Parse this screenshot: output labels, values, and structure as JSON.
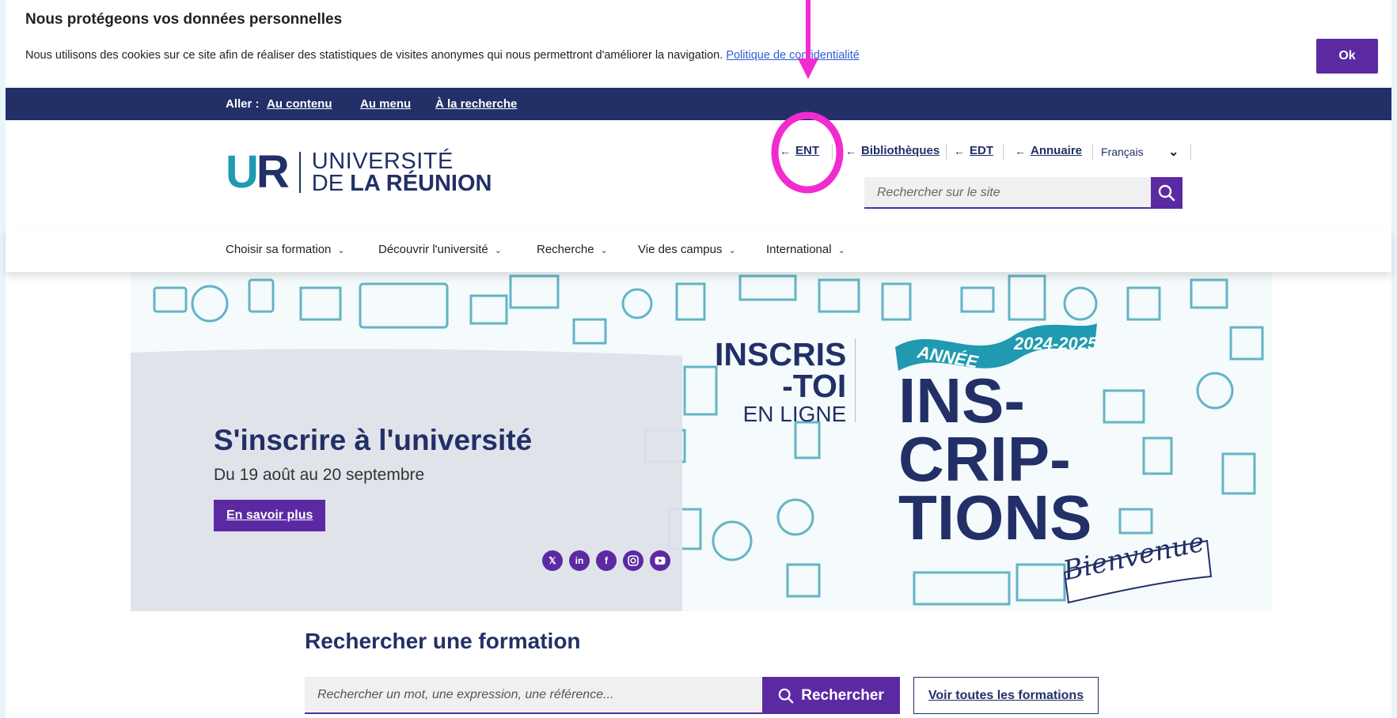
{
  "cookie": {
    "title": "Nous protégeons vos données personnelles",
    "text": "Nous utilisons des cookies sur ce site afin de réaliser des statistiques de visites anonymes qui nous permettront d'améliorer la navigation.",
    "policy_link": "Politique de confidentialité",
    "ok_label": "Ok"
  },
  "skip": {
    "label": "Aller :",
    "links": [
      "Au contenu",
      "Au menu",
      "À la recherche"
    ]
  },
  "header": {
    "logo_mark_u": "U",
    "logo_mark_r": "R",
    "logo_line1": "UNIVERSITÉ",
    "logo_line2_prefix": "DE ",
    "logo_line2_bold": "LA RÉUNION",
    "top_links": [
      "ENT",
      "Bibliothèques",
      "EDT",
      "Annuaire"
    ],
    "language": "Français",
    "search_placeholder": "Rechercher sur le site",
    "arrow_glyph": "←",
    "chevron_glyph": "⌄"
  },
  "nav": {
    "items": [
      "Choisir sa formation",
      "Découvrir l'université",
      "Recherche",
      "Vie des campus",
      "International"
    ]
  },
  "hero": {
    "title": "S'inscrire à l'université",
    "subtitle": "Du 19 août au 20 septembre",
    "button": "En savoir plus",
    "socials": [
      "x-icon",
      "linkedin-icon",
      "facebook-icon",
      "instagram-icon",
      "youtube-icon"
    ],
    "inscris_l1": "INSCRIS",
    "inscris_l2": "-TOI",
    "inscris_l3": "EN LIGNE",
    "annee": "ANNÉE",
    "year": "2024-2025",
    "big_l1": "INS-",
    "big_l2": "CRIP-",
    "big_l3": "TIONS",
    "bienvenue": "Bienvenue"
  },
  "formation": {
    "title": "Rechercher une formation",
    "placeholder": "Rechercher un mot, une expression, une référence...",
    "search_button": "Rechercher",
    "all_button": "Voir toutes les formations"
  },
  "colors": {
    "navy": "#223067",
    "purple": "#5b2aa3",
    "teal": "#1f9ab0",
    "annotation": "#f22bcf"
  }
}
